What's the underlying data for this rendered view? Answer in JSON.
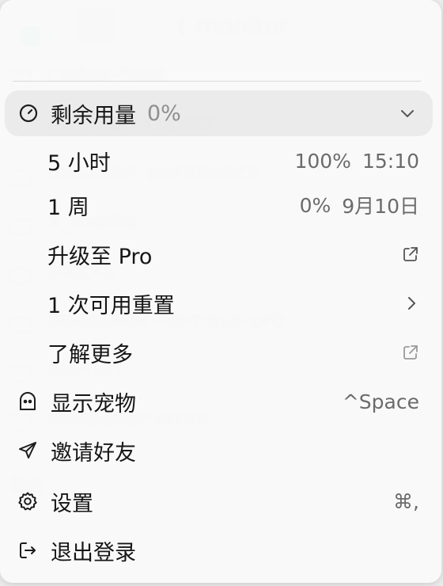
{
  "background": {
    "window_title": "t-monitor",
    "items": [
      "codex-host",
      "obsidian-copilot",
      "obsidian-workbench",
      "x_media",
      "stocks",
      "deepseek-harness-pro",
      "ios-run",
      "wereader-omni",
      "最近"
    ]
  },
  "menu": {
    "usage_header": {
      "label": "剩余用量",
      "percent": "0%",
      "icon": "gauge-icon",
      "chevron": "chevron-down-icon"
    },
    "five_hours": {
      "label": "5 小时",
      "percent": "100%",
      "time": "15:10"
    },
    "one_week": {
      "label": "1 周",
      "percent": "0%",
      "date": "9月10日"
    },
    "upgrade": {
      "label": "升级至 Pro",
      "icon": "external-link-icon"
    },
    "reset": {
      "label": "1 次可用重置",
      "icon": "chevron-right-icon"
    },
    "learn_more": {
      "label": "了解更多",
      "icon": "external-link-icon"
    },
    "show_pet": {
      "label": "显示宠物",
      "shortcut": "^Space",
      "icon": "pet-icon"
    },
    "invite": {
      "label": "邀请好友",
      "icon": "paper-plane-icon"
    },
    "settings": {
      "label": "设置",
      "shortcut": "⌘,",
      "icon": "gear-icon"
    },
    "logout": {
      "label": "退出登录",
      "icon": "logout-icon"
    }
  },
  "colors": {
    "menu_bg": "#fafafa",
    "highlight": "#ececec",
    "text": "#161616",
    "secondary": "#6b6b6b"
  }
}
